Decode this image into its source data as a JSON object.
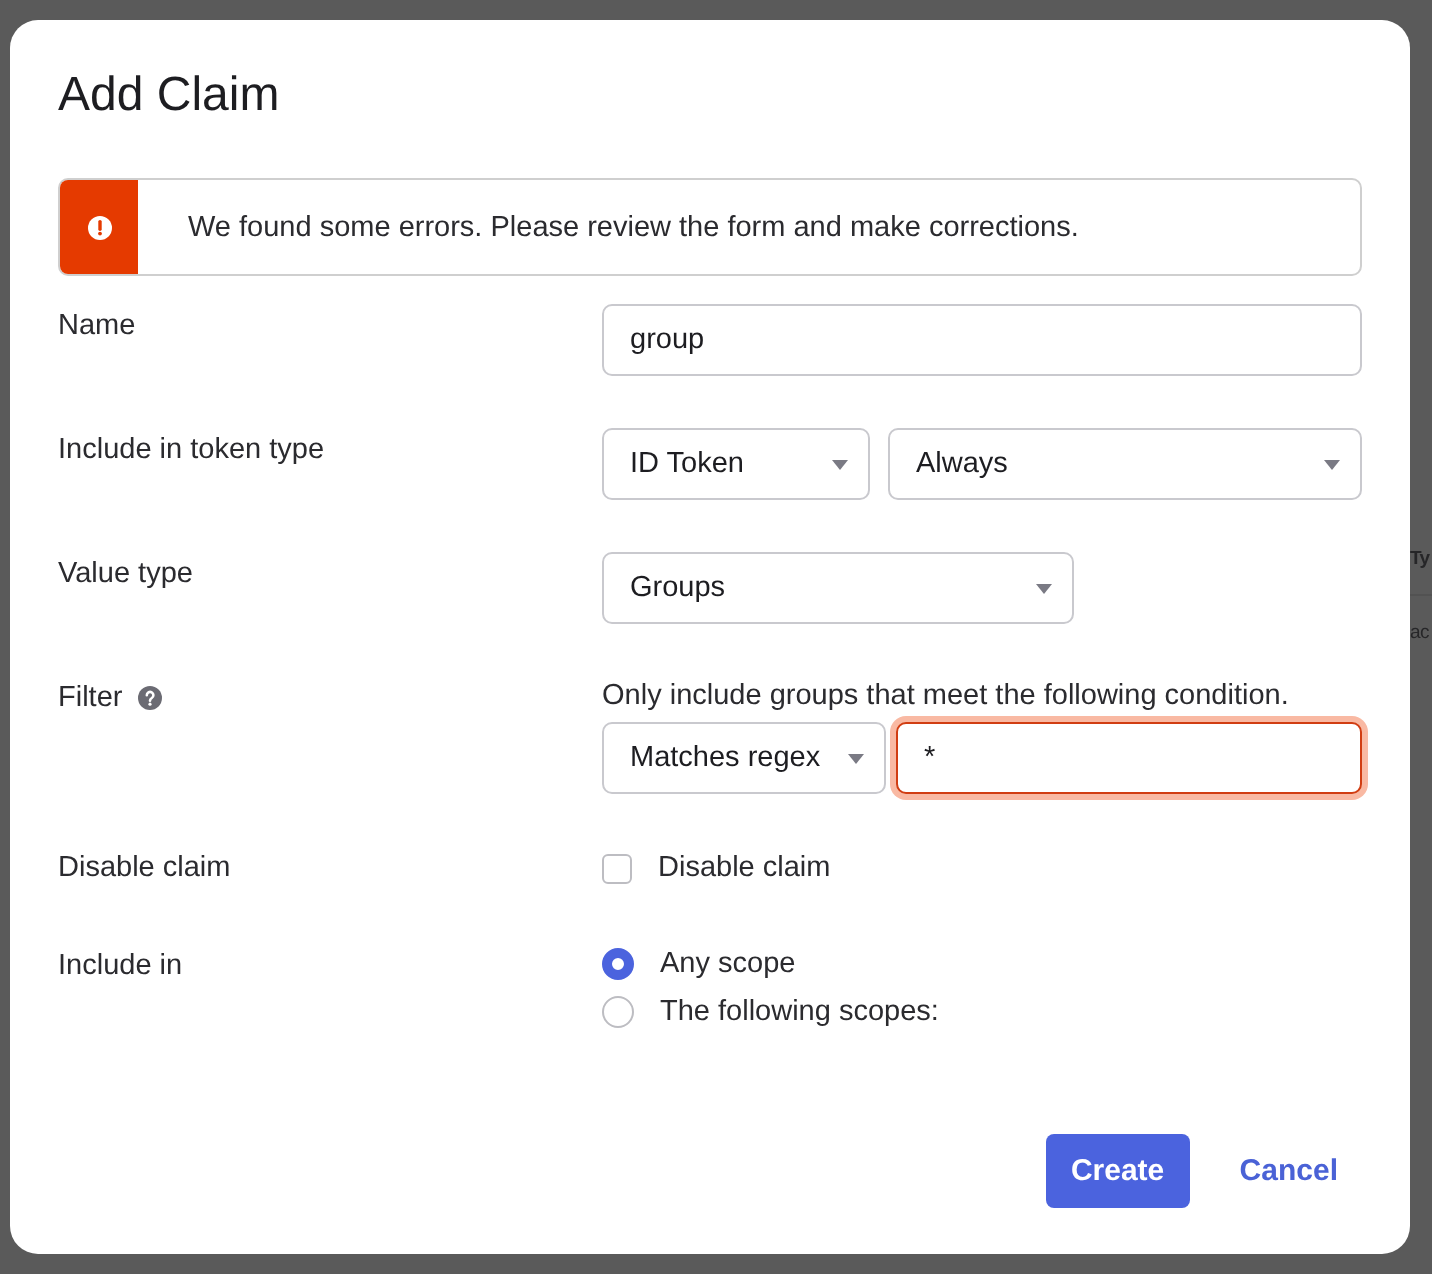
{
  "dialog": {
    "title": "Add Claim"
  },
  "error_banner": {
    "message": "We found some errors. Please review the form and make corrections."
  },
  "fields": [
    {
      "kind": "text",
      "label": "Name",
      "value": "group"
    },
    {
      "kind": "selects",
      "label": "Include in token type",
      "selects": [
        {
          "value": "ID Token"
        },
        {
          "value": "Always"
        }
      ]
    },
    {
      "kind": "selects",
      "label": "Value type",
      "selects": [
        {
          "value": "Groups"
        }
      ]
    },
    {
      "kind": "filter",
      "label": "Filter",
      "help": true,
      "description": "Only include groups that meet the following condition.",
      "operator": "Matches regex",
      "value": "*",
      "error": true
    },
    {
      "kind": "checkbox",
      "label": "Disable claim",
      "option": "Disable claim",
      "checked": false
    },
    {
      "kind": "radio",
      "label": "Include in",
      "options": [
        {
          "label": "Any scope",
          "selected": true
        },
        {
          "label": "The following scopes:",
          "selected": false
        }
      ]
    }
  ],
  "buttons": [
    {
      "kind": "primary",
      "label": "Create"
    },
    {
      "kind": "link",
      "label": "Cancel"
    }
  ],
  "background": {
    "fragments": [
      "Ty",
      "ac"
    ]
  }
}
